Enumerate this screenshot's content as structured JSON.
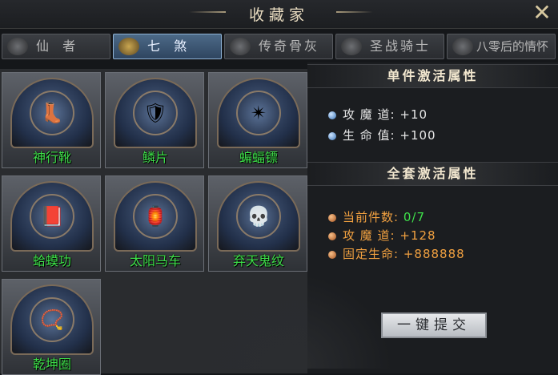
{
  "window": {
    "title": "收藏家",
    "close_icon": "close-icon"
  },
  "tabs": [
    {
      "label": "仙 者",
      "icon": "emblem-icon",
      "active": false
    },
    {
      "label": "七 煞",
      "icon": "winged-emblem-icon",
      "active": true
    },
    {
      "label": "传奇骨灰",
      "icon": "dragon-emblem-icon",
      "active": false
    },
    {
      "label": "圣战骑士",
      "icon": "knight-emblem-icon",
      "active": false
    },
    {
      "label": "八零后的情怀",
      "icon": "sword-emblem-icon",
      "active": false
    }
  ],
  "items": [
    {
      "name": "神行靴",
      "icon": "boots-icon",
      "glyph": "👢"
    },
    {
      "name": "鳞片",
      "icon": "scale-icon",
      "glyph": "🛡"
    },
    {
      "name": "蝙蝠镖",
      "icon": "bat-dart-icon",
      "glyph": "✴"
    },
    {
      "name": "蛤蟆功",
      "icon": "book-icon",
      "glyph": "📕"
    },
    {
      "name": "太阳马车",
      "icon": "chariot-icon",
      "glyph": "🏮"
    },
    {
      "name": "弃天鬼纹",
      "icon": "skull-icon",
      "glyph": "💀"
    },
    {
      "name": "乾坤圈",
      "icon": "ring-icon",
      "glyph": "📿"
    }
  ],
  "single_section": {
    "title": "单件激活属性",
    "attrs": [
      {
        "label": "攻 魔 道:",
        "value": "+10"
      },
      {
        "label": "生 命 值:",
        "value": "+100"
      }
    ]
  },
  "set_section": {
    "title": "全套激活属性",
    "progress_label": "当前件数:",
    "progress_value": "0/7",
    "attrs": [
      {
        "label": "攻 魔 道:",
        "value": "+128"
      },
      {
        "label": "固定生命:",
        "value": "+888888"
      }
    ]
  },
  "submit_label": "一键提交",
  "colors": {
    "item_name": "#3ee04a",
    "set_attr": "#f0a040",
    "active_tab": "#4c6a88"
  }
}
